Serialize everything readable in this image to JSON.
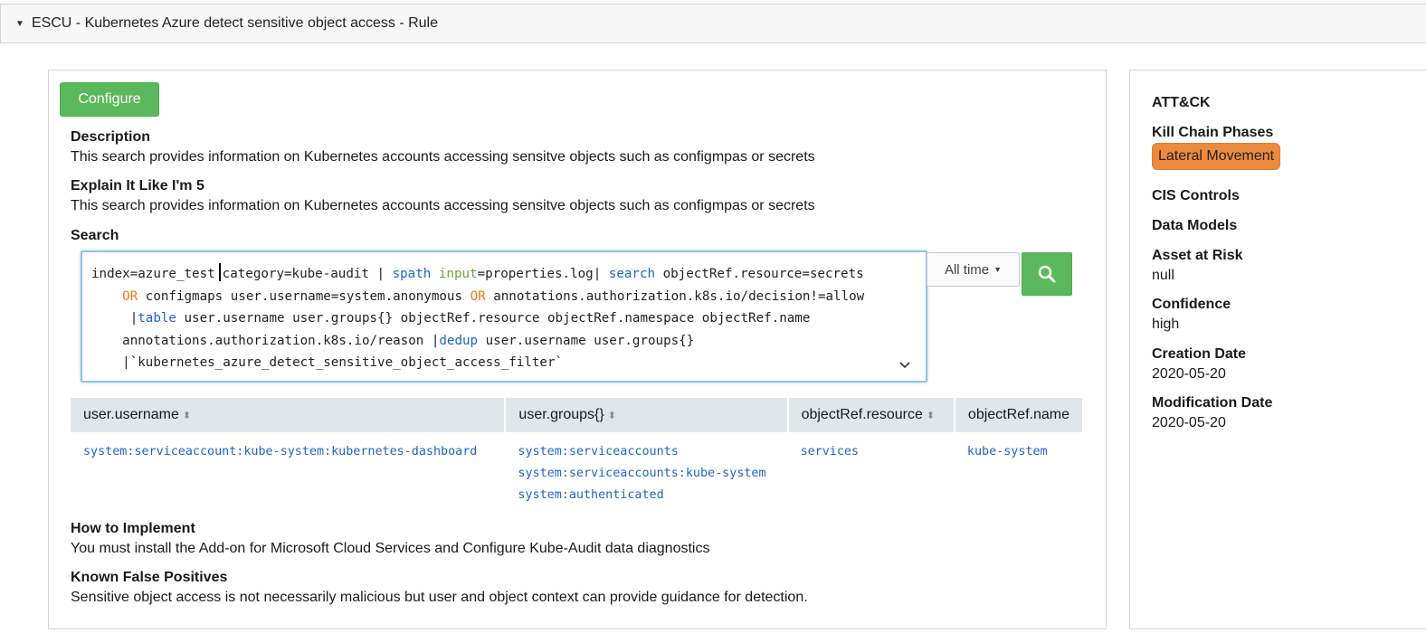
{
  "header": {
    "title": "ESCU - Kubernetes Azure detect sensitive object access - Rule"
  },
  "main": {
    "configure_label": "Configure",
    "description": {
      "label": "Description",
      "text": "This search provides information on Kubernetes accounts accessing sensitve objects such as configmpas or secrets"
    },
    "eli5": {
      "label": "Explain It Like I'm 5",
      "text": "This search provides information on Kubernetes accounts accessing sensitve objects such as configmpas or secrets"
    },
    "search": {
      "label": "Search",
      "time_range": "All time"
    },
    "table": {
      "columns": [
        "user.username",
        "user.groups{}",
        "objectRef.resource",
        "objectRef.name"
      ],
      "rows": [
        {
          "username": "system:serviceaccount:kube-system:kubernetes-dashboard",
          "groups": [
            "system:serviceaccounts",
            "system:serviceaccounts:kube-system",
            "system:authenticated"
          ],
          "resource": "services",
          "name": "kube-system"
        }
      ]
    },
    "how_to_implement": {
      "label": "How to Implement",
      "text": "You must install the Add-on for Microsoft Cloud Services and Configure Kube-Audit data diagnostics"
    },
    "known_false_positives": {
      "label": "Known False Positives",
      "text": "Sensitive object access is not necessarily malicious but user and object context can provide guidance for detection."
    }
  },
  "side": {
    "attck_label": "ATT&CK",
    "kill_chain_label": "Kill Chain Phases",
    "kill_chain_badge": "Lateral Movement",
    "cis_label": "CIS Controls",
    "data_models_label": "Data Models",
    "asset_label": "Asset at Risk",
    "asset_value": "null",
    "confidence_label": "Confidence",
    "confidence_value": "high",
    "creation_label": "Creation Date",
    "creation_value": "2020-05-20",
    "modification_label": "Modification Date",
    "modification_value": "2020-05-20"
  },
  "colors": {
    "accent_green": "#5cb85c",
    "badge_orange": "#ec8a3e",
    "link_blue": "#1f64c4",
    "keyword_orange": "#e67d14",
    "keyword_green": "#65a637"
  }
}
